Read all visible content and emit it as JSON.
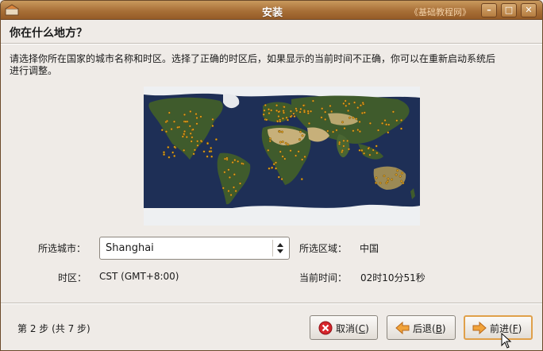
{
  "window": {
    "title": "安装",
    "watermark": "《基础教程网》",
    "minimize_label": "–",
    "maximize_label": "□",
    "close_label": "✕"
  },
  "page": {
    "heading": "你在什么地方？",
    "instructions": "请选择你所在国家的城市名称和时区。选择了正确的时区后，如果显示的当前时间不正确，你可以在重新启动系统后进行调整。"
  },
  "map": {
    "icon": "world-map",
    "colors": {
      "ocean": "#1e2f56",
      "land": "#3f5b2c",
      "desert": "#c7b07a",
      "ice": "#eef0f2",
      "dot": "#e1a21f"
    }
  },
  "location": {
    "city_label": "所选城市：",
    "city_value": "Shanghai",
    "region_label": "所选区域：",
    "region_value": "中国",
    "timezone_label": "时区：",
    "timezone_value": "CST (GMT+8:00)",
    "time_label": "当前时间：",
    "time_value": "02时10分51秒"
  },
  "footer": {
    "step_text": "第 2 步 (共 7 步)",
    "cancel": {
      "text": "取消(",
      "key": "C",
      "end": ")",
      "icon": "cancel-icon"
    },
    "back": {
      "text": "后退(",
      "key": "B",
      "end": ")",
      "icon": "back-arrow-icon"
    },
    "forward": {
      "text": "前进(",
      "key": "F",
      "end": ")",
      "icon": "forward-arrow-icon"
    }
  }
}
